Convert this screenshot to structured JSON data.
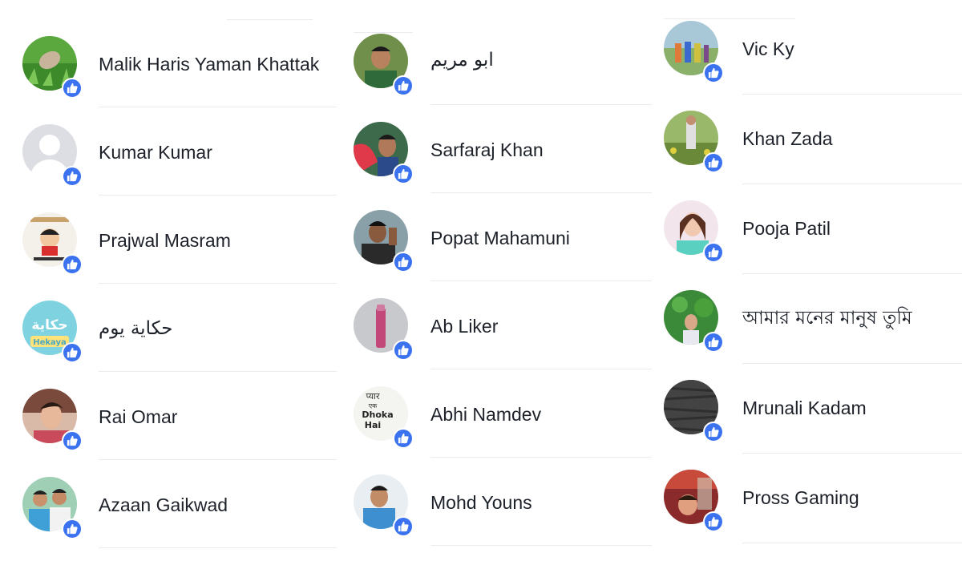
{
  "people": {
    "columns": [
      [
        {
          "name": "Malik Haris Yaman Khattak",
          "avatar": "outdoor-grass-photo"
        },
        {
          "name": "Kumar Kumar",
          "avatar": "default-silhouette"
        },
        {
          "name": "Prajwal Masram",
          "avatar": "cartoon-character"
        },
        {
          "name": "حكاية يوم",
          "avatar": "hekaya-logo"
        },
        {
          "name": "Rai Omar",
          "avatar": "portrait-photo"
        },
        {
          "name": "Azaan Gaikwad",
          "avatar": "group-photo"
        }
      ],
      [
        {
          "name": "ابو مریم",
          "avatar": "outdoor-portrait-photo"
        },
        {
          "name": "Sarfaraj Khan",
          "avatar": "portrait-red-photo"
        },
        {
          "name": "Popat Mahamuni",
          "avatar": "outdoor-portrait-photo"
        },
        {
          "name": "Ab Liker",
          "avatar": "object-photo"
        },
        {
          "name": "Abhi Namdev",
          "avatar": "text-image"
        },
        {
          "name": "Mohd Youns",
          "avatar": "portrait-photo"
        }
      ],
      [
        {
          "name": "Vic Ky",
          "avatar": "group-outdoor-photo"
        },
        {
          "name": "Khan Zada",
          "avatar": "outdoor-photo"
        },
        {
          "name": "Pooja Patil",
          "avatar": "portrait-photo"
        },
        {
          "name": "আমার মনের মানুষ তুমি",
          "avatar": "outdoor-green-photo"
        },
        {
          "name": "Mrunali Kadam",
          "avatar": "texture-dark"
        },
        {
          "name": "Pross Gaming",
          "avatar": "portrait-red-photo"
        }
      ]
    ],
    "avatar_text": {
      "cartoon": "Shin-chan",
      "hekaya": "حكاية",
      "hekaya_sub": "Hekaya",
      "abhi_line1": "प्यार",
      "abhi_line2": "एक",
      "abhi_line3": "Dhoka",
      "abhi_line4": "Hai"
    }
  },
  "badge_icon": "thumbs-up-icon",
  "colors": {
    "like_badge": "#3b72f0",
    "divider": "#e9ebee",
    "name_text": "#1d2129"
  }
}
